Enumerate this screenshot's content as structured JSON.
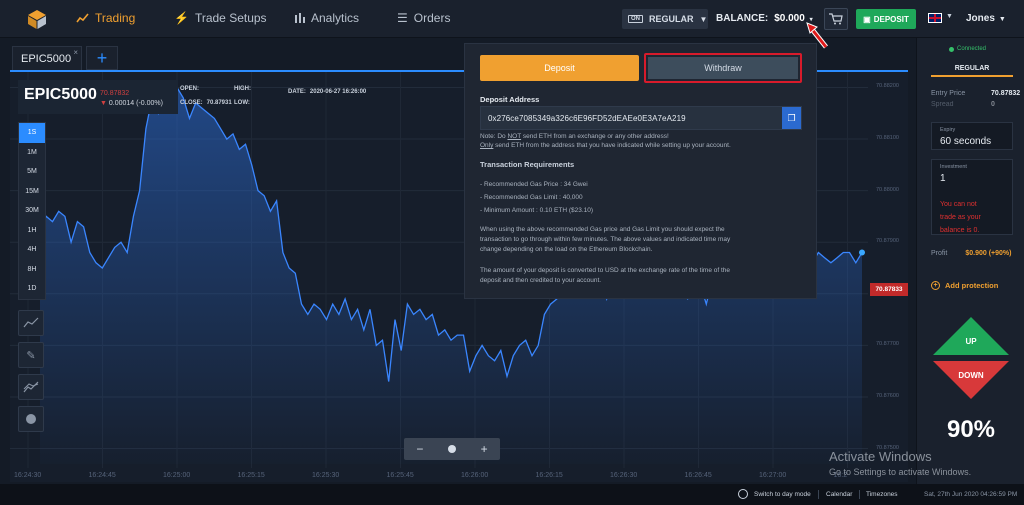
{
  "nav": {
    "items": [
      {
        "label": "Trading",
        "icon": "trading-icon"
      },
      {
        "label": "Trade Setups",
        "icon": "bolt-icon"
      },
      {
        "label": "Analytics",
        "icon": "bars-icon"
      },
      {
        "label": "Orders",
        "icon": "list-icon"
      }
    ],
    "account_tag": "ON",
    "account_mode": "REGULAR",
    "balance_label": "BALANCE:",
    "balance_value": "$0.000",
    "deposit_label": "DEPOSIT",
    "user": "Jones"
  },
  "tabs": [
    {
      "label": "EPIC5000"
    }
  ],
  "asset": {
    "name": "EPIC5000",
    "change_top": "70.87832",
    "change_bottom": "0.00014 (-0.00%)",
    "open_label": "OPEN:",
    "open_value": "",
    "close_label": "CLOSE:",
    "close_value": "70.87931",
    "high_label": "HIGH:",
    "high_value": "",
    "low_label": "LOW:",
    "low_value": "",
    "date_label": "DATE:",
    "date_value": "2020-06-27 16:26:00"
  },
  "timeframes": [
    "1S",
    "1M",
    "5M",
    "15M",
    "30M",
    "1H",
    "4H",
    "8H",
    "1D"
  ],
  "active_timeframe": "1S",
  "chart_data": {
    "type": "line",
    "x_ticks": [
      "16:24:30",
      "16:24:45",
      "16:25:00",
      "16:25:15",
      "16:25:30",
      "16:25:45",
      "16:26:00",
      "16:26:15",
      "16:26:30",
      "16:26:45",
      "16:27:00",
      "16:2"
    ],
    "y_ticks": [
      "70.88200",
      "70.88100",
      "70.88000",
      "70.87900",
      "70.87800",
      "70.87700",
      "70.87600",
      "70.87500"
    ],
    "ylim": [
      70.8747,
      70.8823
    ],
    "x": [
      0,
      0.5,
      1,
      1.5,
      2,
      2.5,
      3,
      3.5,
      4,
      4.5,
      5,
      5.5,
      6,
      6.5,
      7,
      7.5,
      8,
      8.5,
      9,
      9.5,
      10,
      10.5,
      11,
      11.5,
      12,
      12.5,
      13,
      13.5,
      14,
      14.5,
      15,
      15.5,
      16,
      16.5,
      17,
      17.5,
      18,
      18.5,
      19,
      19.5,
      20,
      20.5,
      21,
      21.5,
      22,
      22.5,
      23,
      23.5,
      24,
      24.5,
      25,
      25.5,
      26,
      26.5,
      27,
      27.5,
      28,
      28.5,
      29,
      29.5,
      30,
      30.5,
      31,
      31.5,
      32,
      32.5,
      33,
      33.5,
      34,
      34.5,
      35,
      35.5,
      36,
      36.5,
      37,
      37.5,
      38,
      38.5,
      39,
      39.5,
      40,
      40.5,
      41,
      41.5,
      42,
      42.5,
      43,
      43.5,
      44,
      44.5,
      45,
      45.5,
      46,
      46.5,
      47,
      47.5,
      48,
      48.5,
      49,
      49.5,
      50,
      50.5,
      51,
      51.5,
      52,
      52.5,
      53,
      53.5,
      54,
      54.5,
      55,
      55.5,
      56,
      56.5,
      57,
      57.5,
      58,
      58.5,
      59,
      59.5,
      60,
      60.5,
      61,
      61.5,
      62,
      62.5,
      63,
      63.5,
      64,
      64.5,
      65,
      65.5,
      66
    ],
    "values": [
      70.8793,
      70.8795,
      70.8794,
      70.8796,
      70.8795,
      70.879,
      70.8794,
      70.8793,
      70.8788,
      70.8786,
      70.8785,
      70.8787,
      70.8789,
      70.879,
      70.8788,
      70.8795,
      70.88,
      70.8812,
      70.8818,
      70.8815,
      70.8819,
      70.8818,
      70.882,
      70.8818,
      70.8814,
      70.8817,
      70.8816,
      70.8815,
      70.8814,
      70.8812,
      70.881,
      70.8811,
      70.8808,
      70.8809,
      70.8805,
      70.88,
      70.8799,
      70.8796,
      70.8798,
      70.8788,
      70.8785,
      70.8784,
      70.8778,
      70.8776,
      70.8778,
      70.8777,
      70.8775,
      70.8778,
      70.8776,
      70.8779,
      70.8775,
      70.8777,
      70.8773,
      70.8777,
      70.877,
      70.8771,
      70.8763,
      70.8775,
      70.8769,
      70.8778,
      70.8776,
      70.8777,
      70.8775,
      70.8776,
      70.8772,
      70.8773,
      70.8771,
      70.8772,
      70.8772,
      70.8765,
      70.8768,
      70.877,
      70.8768,
      70.8767,
      70.8769,
      70.8764,
      70.8768,
      70.877,
      70.8771,
      70.8768,
      70.877,
      70.8776,
      70.8778,
      70.8779,
      70.878,
      70.8782,
      70.8781,
      70.8783,
      70.8782,
      70.8784,
      70.8783,
      70.8779,
      70.8783,
      70.8784,
      70.8786,
      70.8783,
      70.8786,
      70.8785,
      70.8784,
      70.8781,
      70.8783,
      70.8782,
      70.878,
      70.8781,
      70.8779,
      70.878,
      70.8782,
      70.8778,
      70.8783,
      70.8784,
      70.8782,
      70.8785,
      70.8786,
      70.8783,
      70.8784,
      70.8787,
      70.8782,
      70.8786,
      70.8786,
      70.8785,
      70.8786,
      70.8787,
      70.8788,
      70.8786,
      70.8786,
      70.8788,
      70.8787,
      70.8786,
      70.8787,
      70.8788,
      70.8788,
      70.8786,
      70.8788
    ],
    "current_price": "70.87833",
    "grid": true
  },
  "zoom": {
    "minus": "−",
    "plus": "+"
  },
  "modal": {
    "deposit_tab": "Deposit",
    "withdraw_tab": "Withdraw",
    "address_label": "Deposit Address",
    "address": "0x276ce7085349a326c6E96FD52dEAEe0E3A7eA219",
    "note_line1_pre": "Note: Do ",
    "note_line1_not": "NOT",
    "note_line1_post": " send ETH from an exchange or any other address!",
    "note_line2_only": "Only",
    "note_line2_post": " send ETH from the address that you have indicated while setting up your account.",
    "req_title": "Transaction Requirements",
    "req_1": "- Recommended Gas Price : 34 Gwei",
    "req_2": "- Recommended Gas Limit : 40,000",
    "req_3": "- Minimum Amount : 0.10 ETH ($23.10)",
    "para1_l1": "When using the above recommended Gas price and Gas Limit you should expect the",
    "para1_l2": "transaction to go through within few minutes. The above values and indicated time may",
    "para1_l3": "change depending on the load on the Ethereum Blockchain.",
    "para2_l1": "The amount of your deposit is converted to USD at the exchange rate of the time of the",
    "para2_l2": "deposit and then credited to your account."
  },
  "panel": {
    "connected": "Connected",
    "mode": "REGULAR",
    "entry_label": "Entry Price",
    "entry_value": "70.87832",
    "spread_label": "Spread",
    "spread_value": "0",
    "expiry_label": "Expiry",
    "expiry_value": "60 seconds",
    "investment_label": "Investment",
    "investment_value": "1",
    "error_l1": "You can not",
    "error_l2": "trade as your",
    "error_l3": "balance is 0.",
    "profit_label": "Profit",
    "profit_value": "$0.900 (+90%)",
    "protect_label": "Add protection",
    "up_label": "UP",
    "down_label": "DOWN",
    "payout": "90%"
  },
  "footer": {
    "day_mode": "Switch to day mode",
    "calendar": "Calendar",
    "timezones": "Timezones",
    "datetime": "Sat, 27th Jun 2020 04:26:59 PM"
  },
  "watermark": {
    "line1": "Activate Windows",
    "line2": "Go to Settings to activate Windows."
  },
  "colors": {
    "accent": "#f0a030",
    "blue": "#2b8cff",
    "up": "#1fa85a",
    "down": "#d8393a",
    "error": "#e03030"
  }
}
